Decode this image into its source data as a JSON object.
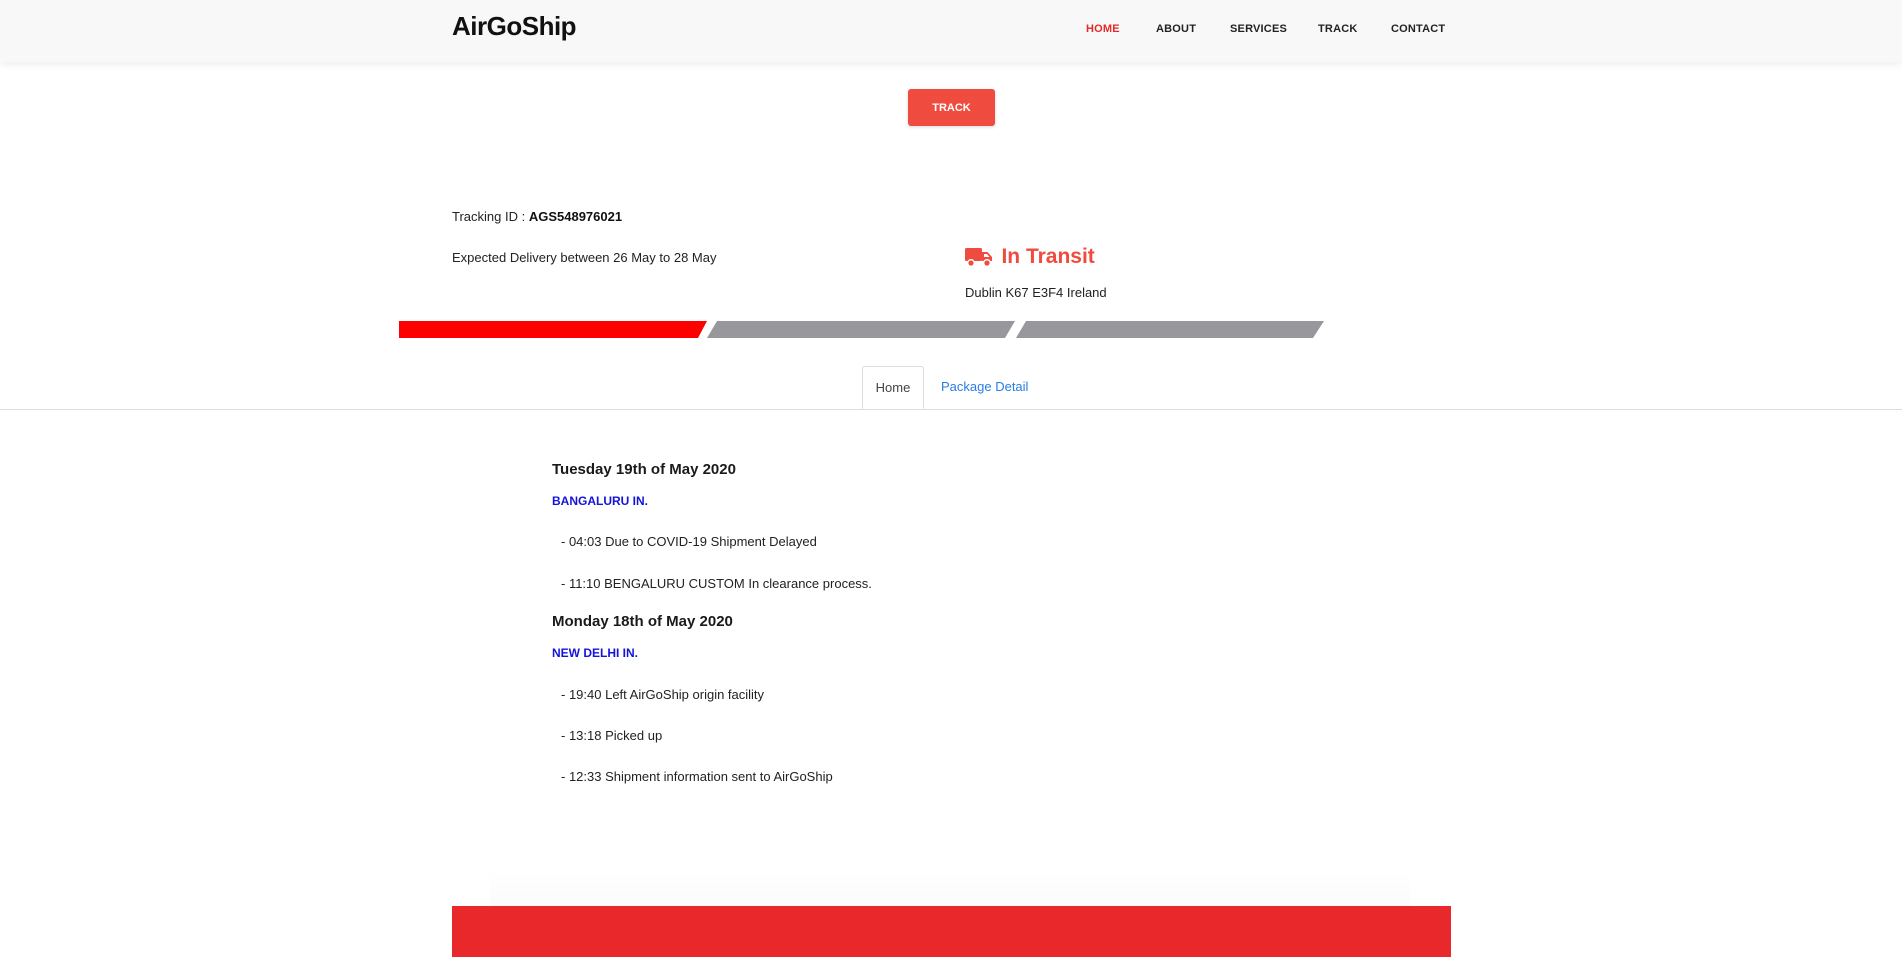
{
  "brand": "AirGoShip",
  "nav": [
    {
      "label": "HOME",
      "active": true
    },
    {
      "label": "ABOUT",
      "active": false
    },
    {
      "label": "SERVICES",
      "active": false
    },
    {
      "label": "TRACK",
      "active": false
    },
    {
      "label": "CONTACT",
      "active": false
    }
  ],
  "track_button": "TRACK",
  "tracking": {
    "label": "Tracking ID : ",
    "id": "AGS548976021",
    "expected": "Expected Delivery between 26 May to 28 May",
    "status": "In Transit",
    "status_icon": "truck-icon",
    "location": "Dublin K67 E3F4 Ireland",
    "progress": {
      "completed_steps": 1,
      "total_steps": 3
    }
  },
  "tabs": [
    {
      "label": "Home",
      "active": true
    },
    {
      "label": "Package Detail",
      "active": false
    }
  ],
  "history": [
    {
      "date": "Tuesday 19th of May 2020",
      "city": "BANGALURU IN.",
      "events": [
        "- 04:03 Due to COVID-19 Shipment Delayed",
        "- 11:10 BENGALURU CUSTOM In clearance process."
      ]
    },
    {
      "date": "Monday 18th of May 2020",
      "city": "NEW DELHI IN.",
      "events": [
        "- 19:40 Left AirGoShip origin facility",
        "- 13:18 Picked up",
        "- 12:33 Shipment information sent to AirGoShip"
      ]
    }
  ],
  "colors": {
    "accent": "#f04b3f",
    "progress_done": "#ff0000",
    "progress_pending": "#98989c",
    "city": "#1414d8",
    "link": "#2a7de1",
    "footer": "#e8282a"
  }
}
